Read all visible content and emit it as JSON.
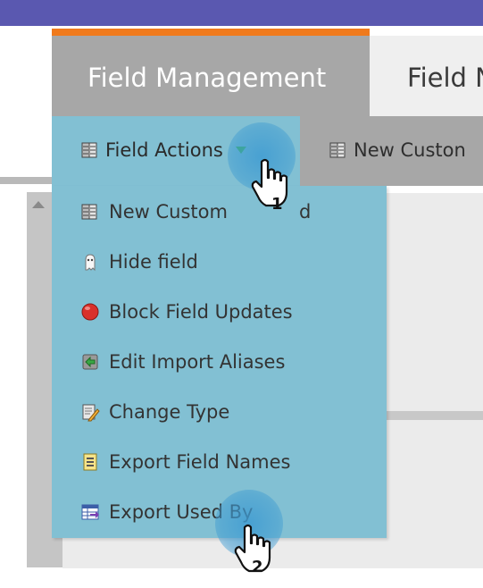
{
  "tabs": [
    {
      "label": "Field Management"
    },
    {
      "label": "Field N"
    }
  ],
  "toolbar": {
    "field_actions_label": "Field Actions",
    "new_custom_label": "New Custon"
  },
  "menu": {
    "items": [
      {
        "label": "New Custom",
        "icon": "new-custom-field-icon"
      },
      {
        "label": "Hide field",
        "icon": "ghost-icon"
      },
      {
        "label": "Block Field Updates",
        "icon": "red-circle-icon"
      },
      {
        "label": "Edit Import Aliases",
        "icon": "import-aliases-icon"
      },
      {
        "label": "Change Type",
        "icon": "change-type-icon"
      },
      {
        "label": "Export Field Names",
        "icon": "export-names-icon"
      },
      {
        "label": "Export Used By",
        "icon": "export-used-by-icon"
      }
    ],
    "last_item_hidden_text": "d"
  },
  "annotations": {
    "step1": "1",
    "step2": "2"
  },
  "colors": {
    "top_bar": "#5a58b0",
    "tab_accent": "#f07a1c",
    "active_tab": "#a7a7a7",
    "menu_bg": "#82c0d3",
    "click_highlight": "#3e9bd2"
  }
}
